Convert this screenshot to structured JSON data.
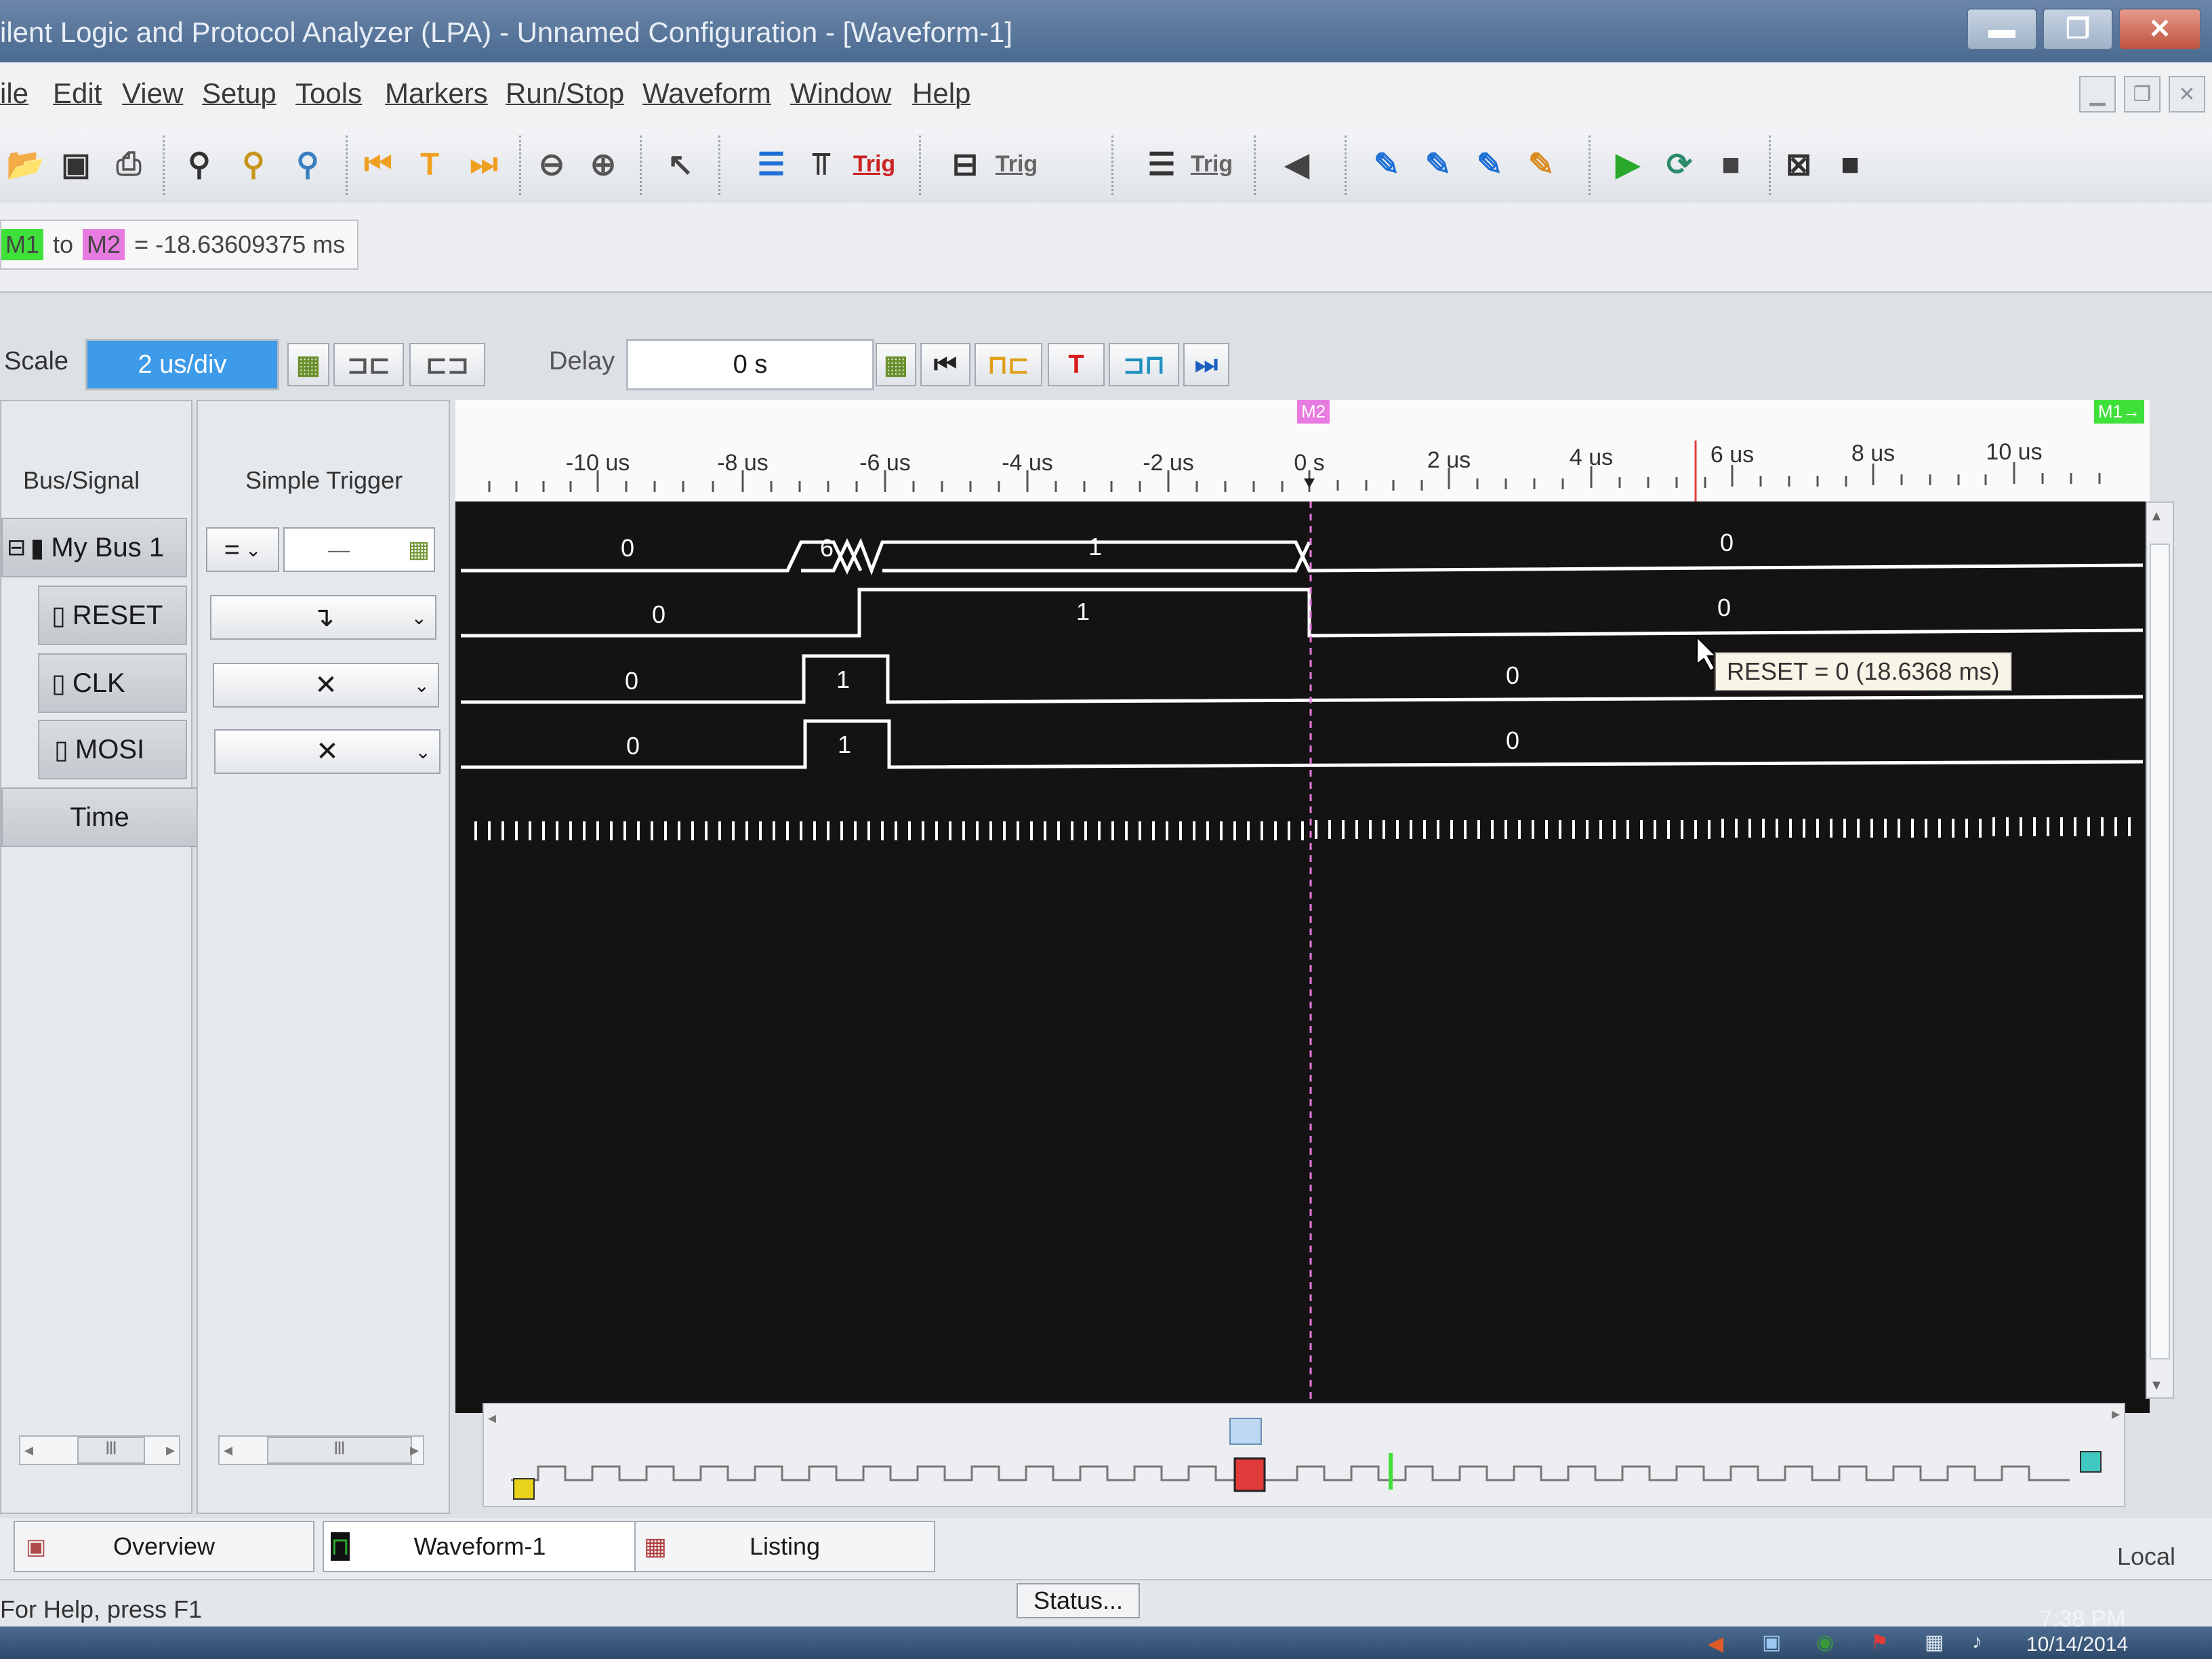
{
  "window": {
    "title": "ilent Logic and Protocol Analyzer (LPA) - Unnamed Configuration - [Waveform-1]",
    "min": "▬",
    "max": "❐",
    "close": "✕"
  },
  "menu": [
    "ile",
    "Edit",
    "View",
    "Setup",
    "Tools",
    "Markers",
    "Run/Stop",
    "Waveform",
    "Window",
    "Help"
  ],
  "toolbar": {
    "trig1": "Trig",
    "trig2": "Trig",
    "trig3": "Trig"
  },
  "markers": {
    "m1": "M1",
    "to": "to",
    "m2": "M2",
    "delta": "= -18.63609375 ms"
  },
  "scale": {
    "label": "Scale",
    "value": "2 us/div",
    "delay_label": "Delay",
    "delay_value": "0 s"
  },
  "signals": {
    "col_header": "Bus/Signal",
    "trigger_header": "Simple Trigger",
    "rows": [
      {
        "name": "My Bus 1",
        "trigger": "=",
        "trigger_value": "—"
      },
      {
        "name": "RESET",
        "trigger": "↴"
      },
      {
        "name": "CLK",
        "trigger": "✕"
      },
      {
        "name": "MOSI",
        "trigger": "✕"
      }
    ],
    "time_label": "Time"
  },
  "ruler": {
    "ticks": [
      "-10 us",
      "-8 us",
      "-6 us",
      "-4 us",
      "-2 us",
      "0 s",
      "2 us",
      "4 us",
      "6 us",
      "8 us",
      "10 us"
    ],
    "m2_flag": "M2",
    "m1_flag": "M1→"
  },
  "waveform": {
    "bus_values": [
      "0",
      "6",
      "1",
      "0"
    ],
    "reset_values": [
      "0",
      "1",
      "0"
    ],
    "clk_values": [
      "0",
      "1",
      "0"
    ],
    "mosi_values": [
      "0",
      "1",
      "0"
    ],
    "tooltip": "RESET = 0 (18.6368 ms)"
  },
  "tabs": [
    "Overview",
    "Waveform-1",
    "Listing"
  ],
  "status": {
    "help": "For Help, press F1",
    "button": "Status...",
    "mode": "Local"
  },
  "taskbar": {
    "time": "7:38 PM",
    "date": "10/14/2014"
  },
  "colors": {
    "m1": "#3fe03a",
    "m2": "#e77be0",
    "wave_bg": "#141212",
    "trace": "#ffffff"
  }
}
